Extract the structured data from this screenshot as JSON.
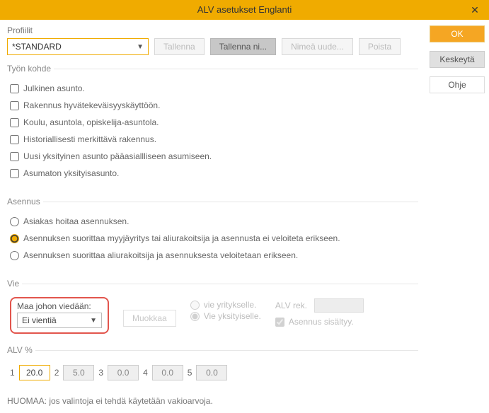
{
  "window": {
    "title": "ALV asetukset Englanti"
  },
  "sideButtons": {
    "ok": "OK",
    "cancel": "Keskeytä",
    "help": "Ohje"
  },
  "profile": {
    "label": "Profiilit",
    "value": "*STANDARD",
    "save": "Tallenna",
    "saveAs": "Tallenna ni...",
    "rename": "Nimeä uude...",
    "delete": "Poista"
  },
  "work": {
    "legend": "Työn kohde",
    "items": [
      "Julkinen asunto.",
      "Rakennus hyvätekeväisyyskäyttöön.",
      "Koulu, asuntola, opiskelija-asuntola.",
      "Historiallisesti merkittävä rakennus.",
      "Uusi yksityinen asunto pääasiallliseen asumiseen.",
      "Asumaton yksityisasunto."
    ]
  },
  "install": {
    "legend": "Asennus",
    "options": [
      "Asiakas hoitaa asennuksen.",
      "Asennuksen suorittaa myyjäyritys tai aliurakoitsija ja asennusta ei veloiteta erikseen.",
      "Asennuksen suorittaa aliurakoitsija ja asennuksesta veloitetaan erikseen."
    ],
    "selectedIndex": 1
  },
  "vie": {
    "legend": "Vie",
    "countryLabel": "Maa johon viedään:",
    "countryValue": "Ei vientiä",
    "edit": "Muokkaa",
    "exportCompany": "vie yritykselle.",
    "exportPrivate": "Vie yksityiselle.",
    "alvRegLabel": "ALV rek.",
    "installIncluded": "Asennus sisältyy."
  },
  "alv": {
    "legend": "ALV %",
    "v1": "20.0",
    "v2": "5.0",
    "v3": "0.0",
    "v4": "0.0",
    "v5": "0.0"
  },
  "note": "HUOMAA: jos valintoja ei tehdä käytetään vakioarvoja."
}
